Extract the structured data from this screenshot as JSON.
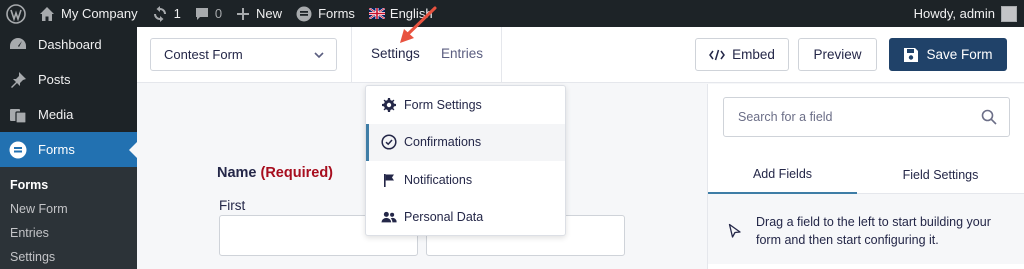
{
  "admin_bar": {
    "site_name": "My Company",
    "updates_count": "1",
    "comments_count": "0",
    "new_label": "New",
    "forms_label": "Forms",
    "language_label": "English",
    "greeting": "Howdy, admin"
  },
  "sidebar": {
    "items": [
      {
        "label": "Dashboard",
        "icon": "dashboard-icon"
      },
      {
        "label": "Posts",
        "icon": "pin-icon"
      },
      {
        "label": "Media",
        "icon": "media-icon"
      },
      {
        "label": "Forms",
        "icon": "forms-icon",
        "active": true
      }
    ],
    "submenu": [
      "Forms",
      "New Form",
      "Entries",
      "Settings"
    ]
  },
  "toolbar": {
    "form_name": "Contest Form",
    "tab_settings": "Settings",
    "tab_entries": "Entries",
    "embed_label": "Embed",
    "preview_label": "Preview",
    "save_label": "Save Form"
  },
  "canvas": {
    "field_label": "Name",
    "required_label": "(Required)",
    "first_label": "First"
  },
  "settings_dropdown": {
    "items": [
      {
        "label": "Form Settings",
        "icon": "gear-icon"
      },
      {
        "label": "Confirmations",
        "icon": "check-circle-icon",
        "active": true
      },
      {
        "label": "Notifications",
        "icon": "flag-icon"
      },
      {
        "label": "Personal Data",
        "icon": "users-icon"
      }
    ]
  },
  "right_panel": {
    "search_placeholder": "Search for a field",
    "tab_add_fields": "Add Fields",
    "tab_field_settings": "Field Settings",
    "hint": "Drag a field to the left to start building your form and then start configuring it."
  },
  "colors": {
    "admin_bg": "#1d2327",
    "wp_blue": "#2271b1",
    "save_button": "#204269",
    "required_red": "#a70d1e",
    "annotation_arrow": "#e8523f"
  }
}
